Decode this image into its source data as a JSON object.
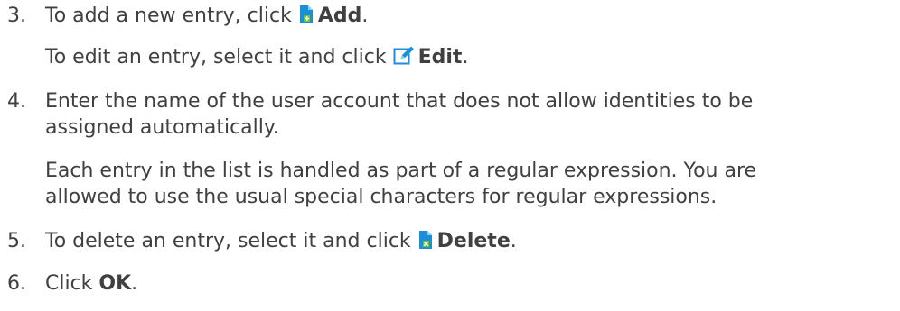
{
  "steps": [
    {
      "number": "3.",
      "lines": [
        {
          "before": "To add a new entry, click ",
          "icon": "add-icon",
          "bold": "Add",
          "after": "."
        },
        {
          "before": "To edit an entry, select it and click ",
          "icon": "edit-icon",
          "bold": "Edit",
          "after": "."
        }
      ]
    },
    {
      "number": "4.",
      "lines": [
        {
          "text": "Enter the name of the user account that does not allow identities to be"
        },
        {
          "text": "assigned automatically."
        },
        {
          "text": "Each entry in the list is handled as part of a regular expression. You are"
        },
        {
          "text": "allowed to use the usual special characters for regular expressions."
        }
      ]
    },
    {
      "number": "5.",
      "lines": [
        {
          "before": "To delete an entry, select it and click ",
          "icon": "delete-icon",
          "bold": "Delete",
          "after": "."
        }
      ]
    },
    {
      "number": "6.",
      "lines": [
        {
          "before": "Click ",
          "bold": "OK",
          "after": "."
        }
      ]
    }
  ],
  "colors": {
    "text": "#404040",
    "icon_blue": "#1d8fd8",
    "icon_green": "#6cc04a",
    "icon_light_blue": "#8dd0f3"
  }
}
